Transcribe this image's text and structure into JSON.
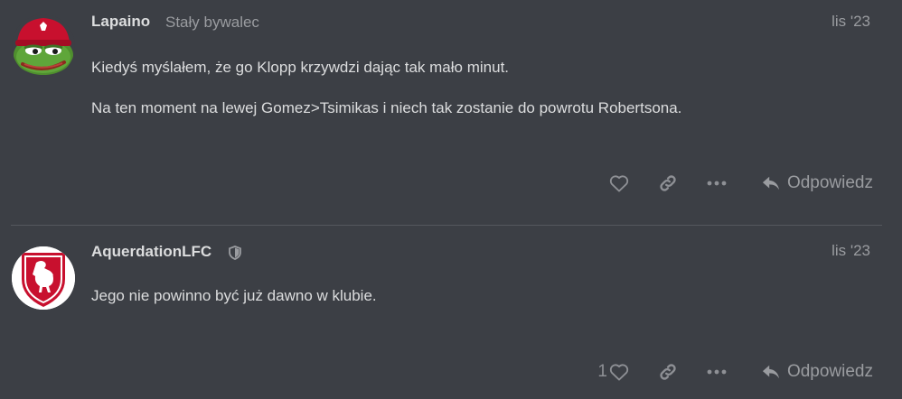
{
  "posts": [
    {
      "username": "Lapaino",
      "user_title": "Stały bywalec",
      "date": "lis '23",
      "paragraphs": [
        "Kiedyś myślałem, że go Klopp krzywdzi dając tak mało minut.",
        "Na ten moment na lewej Gomez>Tsimikas i niech tak zostanie do powrotu Robertsona."
      ],
      "like_count": "",
      "reply_label": "Odpowiedz",
      "avatar_icon": "pepe-frog-liverpool-hat-avatar",
      "icons": [
        "heart-icon",
        "link-icon",
        "ellipsis-icon",
        "reply-arrow-icon"
      ]
    },
    {
      "username": "AquerdationLFC",
      "user_title": "",
      "date": "lis '23",
      "paragraphs": [
        "Jego nie powinno być już dawno w klubie."
      ],
      "like_count": "1",
      "reply_label": "Odpowiedz",
      "avatar_icon": "liverbird-crest-avatar",
      "badge_icon": "shield-icon",
      "icons": [
        "heart-icon",
        "link-icon",
        "ellipsis-icon",
        "reply-arrow-icon"
      ]
    }
  ],
  "colors": {
    "background": "#3c3f45",
    "text": "#dcddde",
    "muted": "#9a9ca0",
    "icon": "#8e9095",
    "divider": "#55585e",
    "lfc_red": "#c8102e"
  }
}
